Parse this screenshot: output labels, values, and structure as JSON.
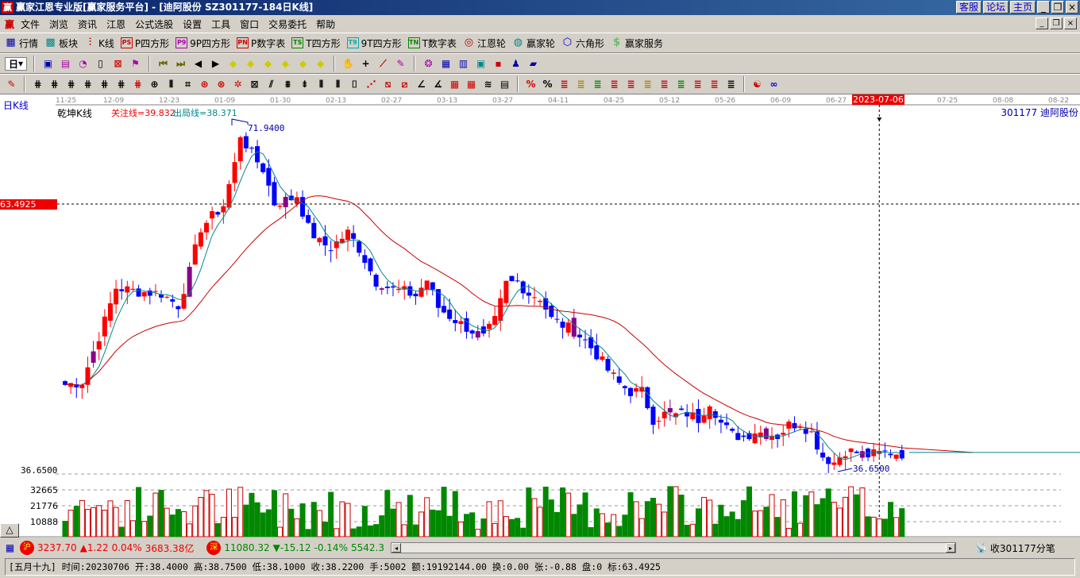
{
  "window": {
    "title": "赢家江恩专业版[赢家服务平台] - [迪阿股份   SZ301177-184日K线]",
    "logo": "赢",
    "top_buttons": [
      "客服",
      "论坛",
      "主页"
    ],
    "win_buttons": [
      "_",
      "❐",
      "×"
    ]
  },
  "menu": {
    "logo": "赢",
    "items": [
      "文件",
      "浏览",
      "资讯",
      "江恩",
      "公式选股",
      "设置",
      "工具",
      "窗口",
      "交易委托",
      "帮助"
    ]
  },
  "toolbar1": [
    {
      "icon": "grid-icon",
      "glyph": "▦",
      "label": "行情",
      "color": "#00a"
    },
    {
      "icon": "blocks-icon",
      "glyph": "▩",
      "label": "板块",
      "color": "#088"
    },
    {
      "icon": "kline-icon",
      "glyph": "⫶",
      "label": "K线",
      "color": "#c00"
    },
    {
      "icon": "ps-icon",
      "glyph": "PS",
      "label": "P四方形",
      "color": "#c00"
    },
    {
      "icon": "p9-icon",
      "glyph": "P9",
      "label": "9P四方形",
      "color": "#a0a"
    },
    {
      "icon": "pn-icon",
      "glyph": "PN",
      "label": "P数字表",
      "color": "#c00"
    },
    {
      "icon": "ts-icon",
      "glyph": "TS",
      "label": "T四方形",
      "color": "#080"
    },
    {
      "icon": "t9-icon",
      "glyph": "T9",
      "label": "9T四方形",
      "color": "#0aa"
    },
    {
      "icon": "tn-icon",
      "glyph": "TN",
      "label": "T数字表",
      "color": "#080"
    },
    {
      "icon": "gann-wheel-icon",
      "glyph": "◎",
      "label": "江恩轮",
      "color": "#a00"
    },
    {
      "icon": "winner-wheel-icon",
      "glyph": "◍",
      "label": "赢家轮",
      "color": "#088"
    },
    {
      "icon": "hexagon-icon",
      "glyph": "⬡",
      "label": "六角形",
      "color": "#00c"
    },
    {
      "icon": "dollar-icon",
      "glyph": "$",
      "label": "赢家服务",
      "color": "#6b6"
    }
  ],
  "toolbar2": {
    "period": "日",
    "icons": [
      [
        "chart-icon",
        "▣",
        "#00a"
      ],
      [
        "table-icon",
        "▤",
        "#a0a"
      ],
      [
        "zoom-icon",
        "◔",
        "#a0a"
      ],
      [
        "bar-icon",
        "▯",
        "#000"
      ],
      [
        "cross-icon",
        "⊠",
        "#c00"
      ],
      [
        "flag-icon",
        "⚑",
        "#a0a"
      ],
      [
        "first-icon",
        "⏮",
        "#660"
      ],
      [
        "last-icon",
        "⏭",
        "#660"
      ],
      [
        "prev-icon",
        "◀",
        "#000"
      ],
      [
        "next-icon",
        "▶",
        "#000"
      ],
      [
        "diamond1-icon",
        "◆",
        "#cc0"
      ],
      [
        "diamond2-icon",
        "◆",
        "#cc0"
      ],
      [
        "diamond3-icon",
        "◆",
        "#cc0"
      ],
      [
        "diamond4-icon",
        "◆",
        "#cc0"
      ],
      [
        "diamond5-icon",
        "◆",
        "#cc0"
      ],
      [
        "diamond6-icon",
        "◆",
        "#cc0"
      ],
      [
        "hand-icon",
        "✋",
        "#000"
      ],
      [
        "plus-icon",
        "+",
        "#000"
      ],
      [
        "line-icon",
        "⟋",
        "#c00"
      ],
      [
        "pen-icon",
        "✎",
        "#a0a"
      ],
      [
        "brain-icon",
        "❂",
        "#a0a"
      ],
      [
        "calc-icon",
        "▦",
        "#00a"
      ],
      [
        "calendar-icon",
        "▥",
        "#00a"
      ],
      [
        "monitor-icon",
        "▣",
        "#088"
      ],
      [
        "save-icon",
        "▪",
        "#c00"
      ],
      [
        "users-icon",
        "♟",
        "#00a"
      ],
      [
        "truck-icon",
        "▰",
        "#00a"
      ]
    ]
  },
  "toolbar3": {
    "icons": [
      [
        "pencil-icon",
        "✎",
        "#c00"
      ],
      [
        "grid1-icon",
        "⋕",
        "#000"
      ],
      [
        "grid2-icon",
        "⋕",
        "#000"
      ],
      [
        "grid3-icon",
        "⋕",
        "#000"
      ],
      [
        "grid4-icon",
        "⋕",
        "#000"
      ],
      [
        "grid5-icon",
        "⋕",
        "#000"
      ],
      [
        "grid6-icon",
        "⋕",
        "#000"
      ],
      [
        "grid7-icon",
        "⋕",
        "#c00"
      ],
      [
        "circle-grid-icon",
        "⊕",
        "#000"
      ],
      [
        "bars-icon",
        "⦀",
        "#000"
      ],
      [
        "stairs-icon",
        "⌗",
        "#000"
      ],
      [
        "fan-icon",
        "⊛",
        "#c00"
      ],
      [
        "target-icon",
        "⊗",
        "#c00"
      ],
      [
        "spiral-icon",
        "✲",
        "#c00"
      ],
      [
        "box-icon",
        "⊠",
        "#000"
      ],
      [
        "ray-icon",
        "⫽",
        "#000"
      ],
      [
        "pitch-icon",
        "⩩",
        "#000"
      ],
      [
        "arrows-icon",
        "⇟",
        "#000"
      ],
      [
        "vert-icon",
        "⦀",
        "#000"
      ],
      [
        "hbars-icon",
        "⫴",
        "#000"
      ],
      [
        "pipe-icon",
        "⌷",
        "#000"
      ],
      [
        "fan2-icon",
        "⋰",
        "#c00"
      ],
      [
        "fan3-icon",
        "⧅",
        "#c00"
      ],
      [
        "fan4-icon",
        "⧄",
        "#c00"
      ],
      [
        "angle-icon",
        "∠",
        "#000"
      ],
      [
        "angle2-icon",
        "∡",
        "#000"
      ],
      [
        "box2-icon",
        "▦",
        "#c00"
      ],
      [
        "box3-icon",
        "▦",
        "#c00"
      ],
      [
        "lines-icon",
        "≋",
        "#000"
      ],
      [
        "doc-icon",
        "▤",
        "#000"
      ],
      [
        "pct1-icon",
        "%",
        "#c00"
      ],
      [
        "pct-icon",
        "%",
        "#000"
      ],
      [
        "eq1-icon",
        "≣",
        "#c00"
      ],
      [
        "eq2-icon",
        "≣",
        "#a80"
      ],
      [
        "eq3-icon",
        "≣",
        "#080"
      ],
      [
        "eq4-icon",
        "≣",
        "#c00"
      ],
      [
        "eq5-icon",
        "≣",
        "#c00"
      ],
      [
        "eq6-icon",
        "≣",
        "#a80"
      ],
      [
        "eq7-icon",
        "≣",
        "#c00"
      ],
      [
        "eq8-icon",
        "≣",
        "#080"
      ],
      [
        "eq9-icon",
        "≣",
        "#c00"
      ],
      [
        "eq10-icon",
        "≣",
        "#c00"
      ],
      [
        "eq11-icon",
        "≣",
        "#000"
      ],
      [
        "yinyang-icon",
        "☯",
        "#c00"
      ],
      [
        "infinity-icon",
        "∞",
        "#00c"
      ]
    ]
  },
  "chart": {
    "period_label": "日K线",
    "indicator_name": "乾坤K线",
    "watch_line": "关注线=39.832",
    "exit_line": "出局线=38.371",
    "stock": "301177  迪阿股份",
    "high_label": "71.9400",
    "low_label": "36.6500",
    "cursor_price": "63.4925",
    "cursor_date": "2023-07-06",
    "vol_top_label": "36.6500",
    "vol_ticks": [
      "32665",
      "21776",
      "10888"
    ],
    "toggle": "△"
  },
  "chart_data": {
    "type": "candlestick",
    "dates": [
      "11-25",
      "12-09",
      "12-23",
      "01-09",
      "01-30",
      "02-13",
      "02-27",
      "03-13",
      "03-27",
      "04-11",
      "04-25",
      "05-12",
      "05-26",
      "06-09",
      "06-27",
      "07-25",
      "08-08",
      "08-22"
    ],
    "price_range": [
      36.65,
      71.94
    ],
    "close_keypoints": [
      [
        0,
        45.5
      ],
      [
        3,
        45.8
      ],
      [
        7,
        52
      ],
      [
        9,
        55.4
      ],
      [
        13,
        55
      ],
      [
        17,
        54.8
      ],
      [
        20,
        53.6
      ],
      [
        22,
        57
      ],
      [
        24,
        61.5
      ],
      [
        28,
        63.8
      ],
      [
        30,
        68
      ],
      [
        31,
        71
      ],
      [
        33,
        69
      ],
      [
        35,
        67.5
      ],
      [
        37,
        64
      ],
      [
        40,
        64.5
      ],
      [
        41,
        64.8
      ],
      [
        43,
        61.5
      ],
      [
        45,
        60
      ],
      [
        47,
        59.5
      ],
      [
        50,
        61
      ],
      [
        52,
        59.4
      ],
      [
        55,
        56
      ],
      [
        58,
        55.2
      ],
      [
        60,
        55
      ],
      [
        62,
        54.6
      ],
      [
        64,
        56.2
      ],
      [
        66,
        53.4
      ],
      [
        68,
        52.5
      ],
      [
        70,
        51.7
      ],
      [
        72,
        51
      ],
      [
        74,
        50.3
      ],
      [
        76,
        52
      ],
      [
        78,
        55.8
      ],
      [
        80,
        56
      ],
      [
        82,
        54.8
      ],
      [
        84,
        54.4
      ],
      [
        86,
        52.2
      ],
      [
        88,
        51.6
      ],
      [
        90,
        51
      ],
      [
        92,
        50
      ],
      [
        94,
        48.6
      ],
      [
        96,
        47
      ],
      [
        98,
        45.6
      ],
      [
        100,
        44.8
      ],
      [
        102,
        44.8
      ],
      [
        104,
        42
      ],
      [
        106,
        42.5
      ],
      [
        108,
        42.4
      ],
      [
        110,
        42.6
      ],
      [
        112,
        42
      ],
      [
        114,
        43.8
      ],
      [
        116,
        41.6
      ],
      [
        118,
        40.4
      ],
      [
        120,
        40.2
      ],
      [
        122,
        40.8
      ],
      [
        124,
        40.5
      ],
      [
        126,
        40.3
      ],
      [
        128,
        41.4
      ],
      [
        130,
        41.6
      ],
      [
        132,
        40.6
      ],
      [
        134,
        38.2
      ],
      [
        136,
        37.6
      ],
      [
        138,
        38.8
      ],
      [
        140,
        38.6
      ],
      [
        142,
        38.3
      ],
      [
        144,
        38.5
      ],
      [
        146,
        38.6
      ],
      [
        148,
        38.5
      ]
    ],
    "cursor_index": 144,
    "volume_ticks": [
      10888,
      21776,
      32665
    ]
  },
  "status": {
    "sh_badge": "沪",
    "sh_value": "3237.70",
    "sh_change": "▲1.22",
    "sh_pct": "0.04%",
    "sh_amount": "3683.38亿",
    "sz_badge": "深",
    "sz_value": "11080.32",
    "sz_change": "▼-15.12",
    "sz_pct": "-0.14%",
    "sz_amount": "5542.3",
    "receive": "收301177分笔"
  },
  "quote_line": "[五月十九] 时间:20230706 开:38.4000 高:38.7500 低:38.1000 收:38.2200 手:5002 额:19192144.00 换:0.00 张:-0.88 盘:0 标:63.4925"
}
